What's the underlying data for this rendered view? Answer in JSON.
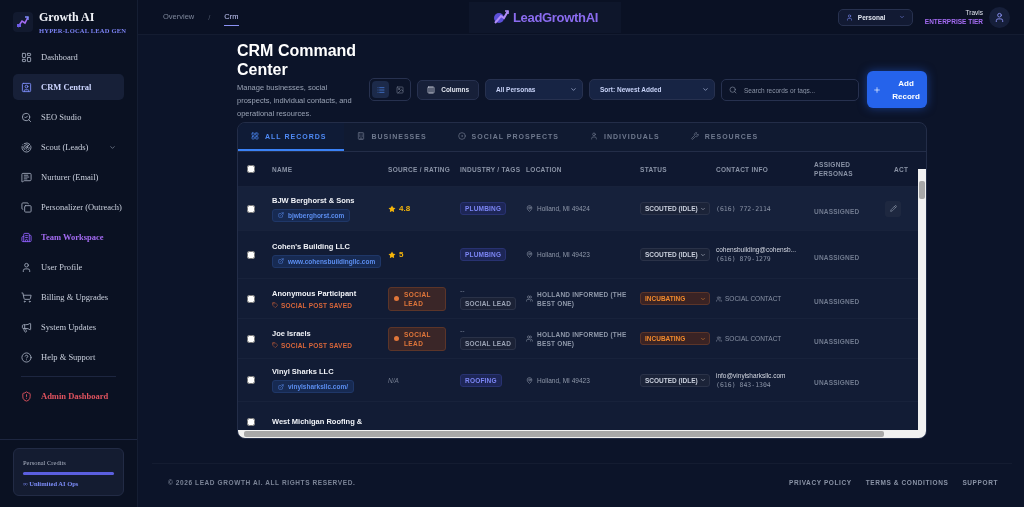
{
  "sidebar": {
    "brand": {
      "name": "Growth AI",
      "tagline": "HYPER-LOCAL LEAD GEN"
    },
    "items": [
      {
        "label": "Dashboard",
        "kind": "nav",
        "selected": false,
        "submenu": false
      },
      {
        "label": "CRM Central",
        "kind": "nav",
        "selected": true,
        "submenu": false
      },
      {
        "label": "SEO Studio",
        "kind": "nav",
        "selected": false,
        "submenu": false
      },
      {
        "label": "Scout (Leads)",
        "kind": "nav",
        "selected": false,
        "submenu": true
      },
      {
        "label": "Nurturer (Email)",
        "kind": "nav",
        "selected": false,
        "submenu": false
      },
      {
        "label": "Personalizer (Outreach)",
        "kind": "nav",
        "selected": false,
        "submenu": false
      },
      {
        "label": "Team Workspace",
        "kind": "workspace",
        "selected": false,
        "submenu": false
      },
      {
        "label": "User Profile",
        "kind": "nav",
        "selected": false,
        "submenu": false
      },
      {
        "label": "Billing & Upgrades",
        "kind": "nav",
        "selected": false,
        "submenu": false
      },
      {
        "label": "System Updates",
        "kind": "nav",
        "selected": false,
        "submenu": false
      },
      {
        "label": "Help & Support",
        "kind": "nav",
        "selected": false,
        "submenu": false
      },
      {
        "label": "Admin Dashboard",
        "kind": "admin",
        "selected": false,
        "submenu": false
      }
    ],
    "credits": {
      "title": "Personal Credits",
      "level": 1,
      "caption": "∞ Unlimited AI Ops"
    }
  },
  "topbar": {
    "breadcrumbs": [
      {
        "label": "Overview",
        "selected": false
      },
      {
        "label": "Crm",
        "selected": true
      }
    ],
    "separator": "/",
    "logo": "LeadGrowthAI",
    "persona": "Personal",
    "user": {
      "name": "Travis",
      "tier": "ENTERPRISE TIER"
    }
  },
  "header": {
    "title": "CRM Command Center",
    "subtitle": "Manage businesses, social prospects, individual contacts, and operational resources."
  },
  "toolbar": {
    "views": [
      {
        "kind": "list",
        "selected": true
      },
      {
        "kind": "grid",
        "selected": false
      }
    ],
    "columns_button": "Columns",
    "persona_filter": "All Personas",
    "sort": "Sort: Newest Added",
    "search_placeholder": "Search records or tags...",
    "add_button": "Add Record"
  },
  "tabs": [
    {
      "label": "ALL RECORDS",
      "selected": true
    },
    {
      "label": "BUSINESSES",
      "selected": false
    },
    {
      "label": "SOCIAL PROSPECTS",
      "selected": false
    },
    {
      "label": "INDIVIDUALS",
      "selected": false
    },
    {
      "label": "RESOURCES",
      "selected": false
    }
  ],
  "table": {
    "select_all_checked": false,
    "columns": [
      "NAME",
      "SOURCE / RATING",
      "INDUSTRY / TAGS",
      "LOCATION",
      "STATUS",
      "CONTACT INFO",
      "ASSIGNED PERSONAS",
      "ACT"
    ],
    "rows": [
      {
        "checked": false,
        "hovered": true,
        "name": "BJW Berghorst & Sons",
        "link": "bjwberghorst.com",
        "source": {
          "kind": "rating",
          "text": "4.8"
        },
        "tag": {
          "kind": "industry",
          "text": "PLUMBING"
        },
        "location": {
          "kind": "address",
          "text": "Holland, MI 49424"
        },
        "status": {
          "kind": "scouted",
          "text": "SCOUTED (IDLE)"
        },
        "contact": {
          "kind": "business",
          "phone": "(616) 772-2114"
        },
        "assigned": "UNASSIGNED"
      },
      {
        "checked": false,
        "hovered": false,
        "name": "Cohen's Building LLC",
        "link": "www.cohensbuildingllc.com",
        "source": {
          "kind": "rating",
          "text": "5"
        },
        "tag": {
          "kind": "industry",
          "text": "PLUMBING"
        },
        "location": {
          "kind": "address",
          "text": "Holland, MI 49423"
        },
        "status": {
          "kind": "scouted",
          "text": "SCOUTED (IDLE)"
        },
        "contact": {
          "kind": "business",
          "email": "cohensbuilding@cohensb...",
          "phone": "(616) 879-1279"
        },
        "assigned": "UNASSIGNED"
      },
      {
        "checked": false,
        "hovered": false,
        "name": "Anonymous Participant",
        "note": "SOCIAL POST SAVED",
        "source": {
          "kind": "social",
          "text": "SOCIAL LEAD"
        },
        "tag": {
          "kind": "social",
          "dash": "--",
          "text": "SOCIAL LEAD"
        },
        "location": {
          "kind": "group",
          "text": "HOLLAND INFORMED (THE BEST ONE)"
        },
        "status": {
          "kind": "incubating",
          "text": "INCUBATING"
        },
        "contact": {
          "kind": "social",
          "text": "SOCIAL CONTACT"
        },
        "assigned": "UNASSIGNED"
      },
      {
        "checked": false,
        "hovered": false,
        "name": "Joe Israels",
        "note": "SOCIAL POST SAVED",
        "source": {
          "kind": "social",
          "text": "SOCIAL LEAD"
        },
        "tag": {
          "kind": "social",
          "dash": "--",
          "text": "SOCIAL LEAD"
        },
        "location": {
          "kind": "group",
          "text": "HOLLAND INFORMED (THE BEST ONE)"
        },
        "status": {
          "kind": "incubating",
          "text": "INCUBATING"
        },
        "contact": {
          "kind": "social",
          "text": "SOCIAL CONTACT"
        },
        "assigned": "UNASSIGNED"
      },
      {
        "checked": false,
        "hovered": false,
        "name": "Vinyl Sharks LLC",
        "link": "vinylsharksllc.com/",
        "source": {
          "kind": "none",
          "text": "N/A"
        },
        "tag": {
          "kind": "industry",
          "text": "ROOFING"
        },
        "location": {
          "kind": "address",
          "text": "Holland, MI 49423"
        },
        "status": {
          "kind": "scouted",
          "text": "SCOUTED (IDLE)"
        },
        "contact": {
          "kind": "business",
          "email": "info@vinylsharksllc.com",
          "phone": "(616) 843-1304"
        },
        "assigned": "UNASSIGNED"
      },
      {
        "checked": false,
        "hovered": false,
        "name": "West Michigan Roofing &"
      }
    ]
  },
  "footer": {
    "copyright": "© 2026 LEAD GROWTH AI. ALL RIGHTS RESERVED.",
    "links": [
      "PRIVACY POLICY",
      "TERMS & CONDITIONS",
      "SUPPORT"
    ]
  }
}
